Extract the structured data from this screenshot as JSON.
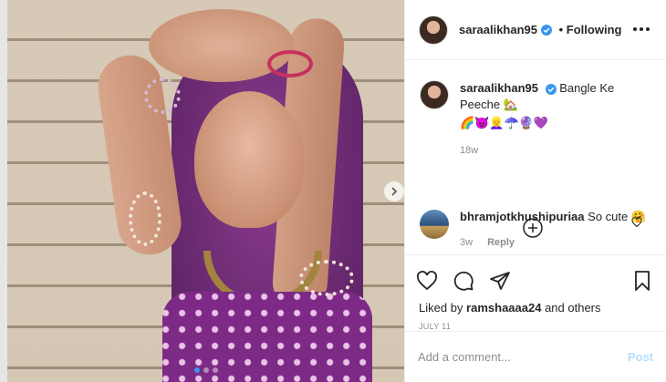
{
  "post": {
    "username": "saraalikhan95",
    "follow_status": "Following",
    "caption_text": "Bangle Ke Peeche 🏡",
    "caption_emojis": "🌈😈👱‍♀️☂️🔮💜",
    "caption_age": "18w",
    "likes_prefix": "Liked by",
    "likes_user": "ramshaaaa24",
    "likes_suffix": "and others",
    "date": "JULY 11",
    "carousel_dots": 3,
    "carousel_active": 1
  },
  "comment": {
    "username": "bhramjotkhushipuriaa",
    "text": "So cute 🤗",
    "age": "3w",
    "reply_label": "Reply"
  },
  "composer": {
    "placeholder": "Add a comment...",
    "post_label": "Post"
  },
  "icons": {
    "verified": "verified-badge-icon",
    "more": "more-options-icon",
    "like": "heart-icon",
    "comment": "comment-bubble-icon",
    "share": "paper-plane-icon",
    "save": "bookmark-icon",
    "load_more": "plus-circle-icon",
    "next": "chevron-right-icon"
  },
  "colors": {
    "accent": "#3897f0",
    "post_button_disabled": "#b2dffc",
    "muted_text": "#8e8e8e"
  }
}
